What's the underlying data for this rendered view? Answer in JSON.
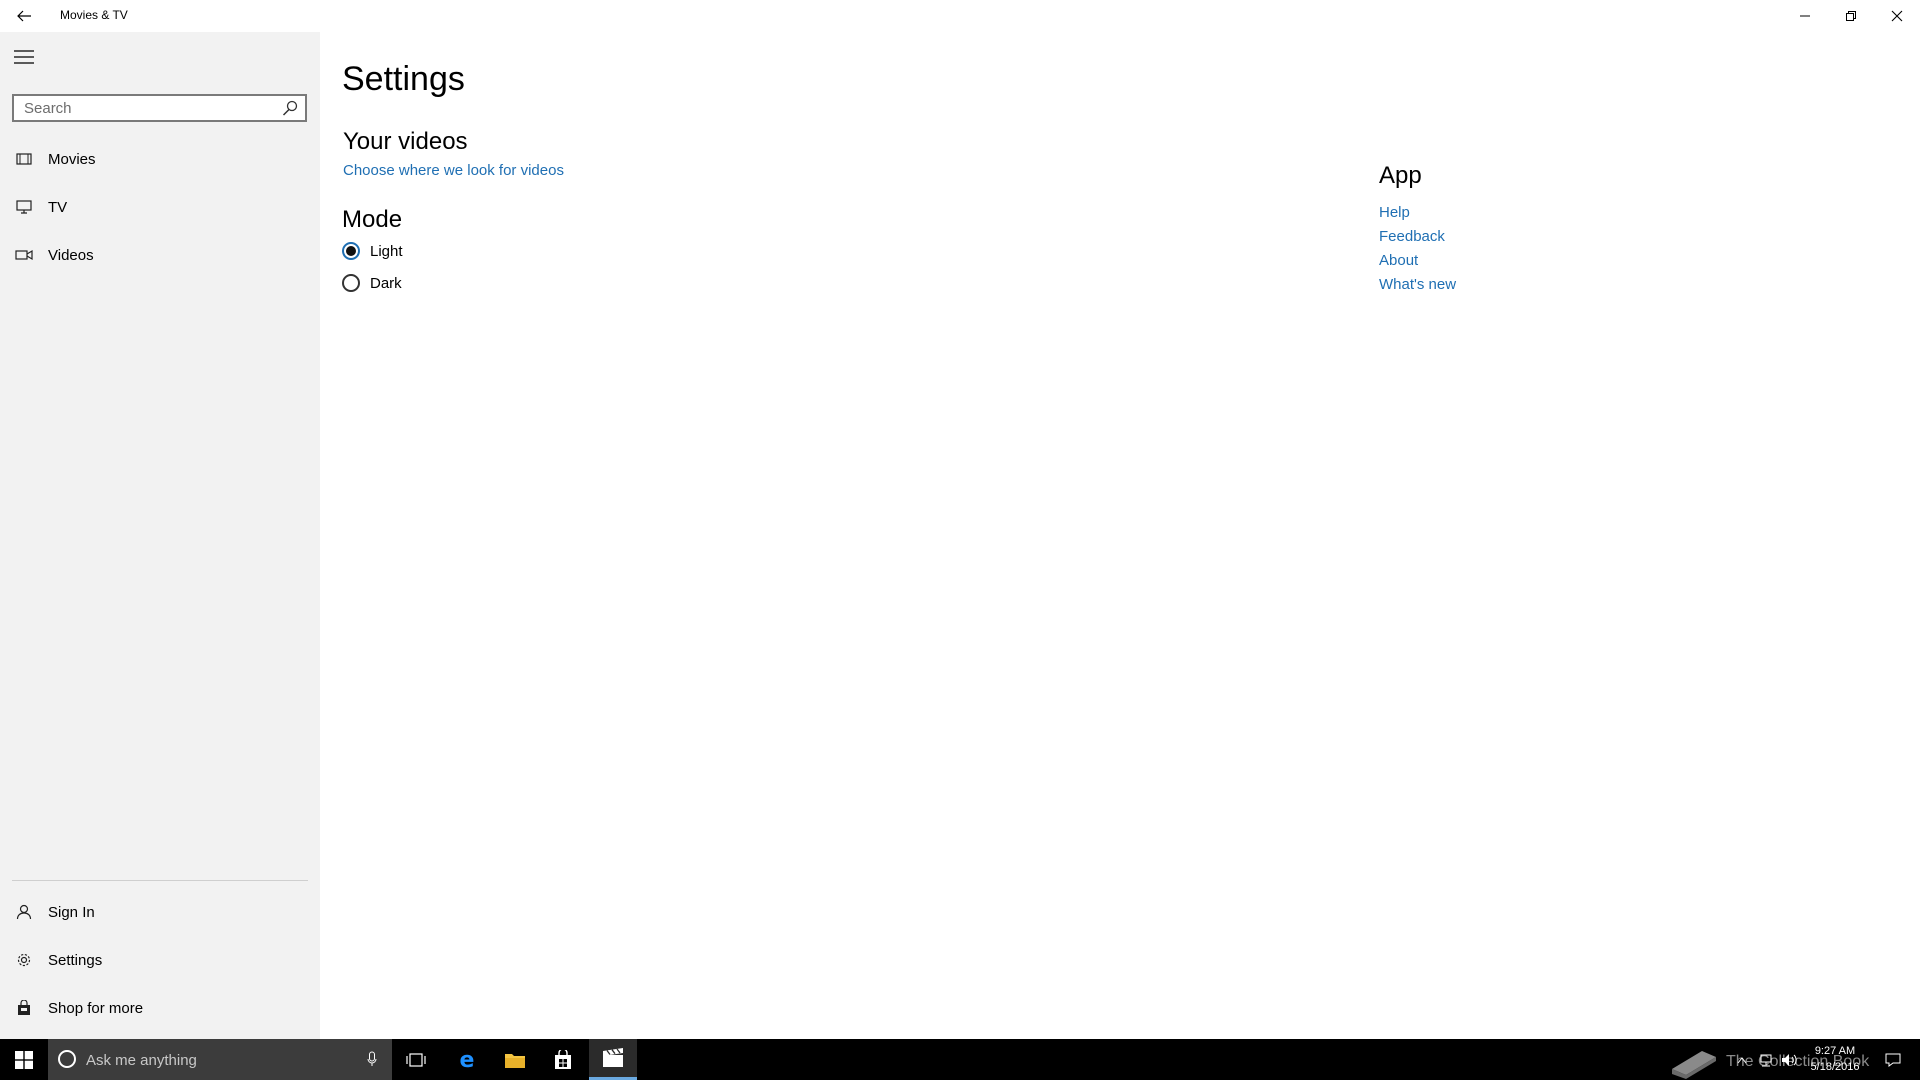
{
  "window": {
    "title": "Movies & TV",
    "back_icon": "back-arrow-icon",
    "minimize_icon": "minimize-icon",
    "maximize_icon": "restore-icon",
    "close_icon": "close-icon"
  },
  "sidebar": {
    "search": {
      "placeholder": "Search",
      "value": ""
    },
    "nav_items": [
      {
        "label": "Movies",
        "icon": "movies-icon"
      },
      {
        "label": "TV",
        "icon": "tv-icon"
      },
      {
        "label": "Videos",
        "icon": "videos-icon"
      }
    ],
    "bottom_items": [
      {
        "label": "Sign In",
        "icon": "person-icon"
      },
      {
        "label": "Settings",
        "icon": "gear-icon"
      },
      {
        "label": "Shop for more",
        "icon": "shopping-bag-icon"
      }
    ]
  },
  "settings": {
    "title": "Settings",
    "your_videos": {
      "heading": "Your videos",
      "link": "Choose where we look for videos"
    },
    "mode": {
      "heading": "Mode",
      "options": [
        {
          "label": "Light",
          "selected": true
        },
        {
          "label": "Dark",
          "selected": false
        }
      ]
    },
    "app": {
      "heading": "App",
      "links": [
        "Help",
        "Feedback",
        "About",
        "What's new"
      ]
    }
  },
  "colors": {
    "accent": "#1f6fb3",
    "sidebar_bg": "#f2f2f2",
    "taskbar_bg": "#000000"
  },
  "taskbar": {
    "search_placeholder": "Ask me anything",
    "clock": {
      "time": "9:27 AM",
      "date": "5/18/2016"
    },
    "watermark_text": "The Collection Book",
    "apps": [
      "task-view-icon",
      "edge-icon",
      "file-explorer-icon",
      "store-icon",
      "movies-tv-icon"
    ],
    "active_app": "movies-tv-icon"
  }
}
